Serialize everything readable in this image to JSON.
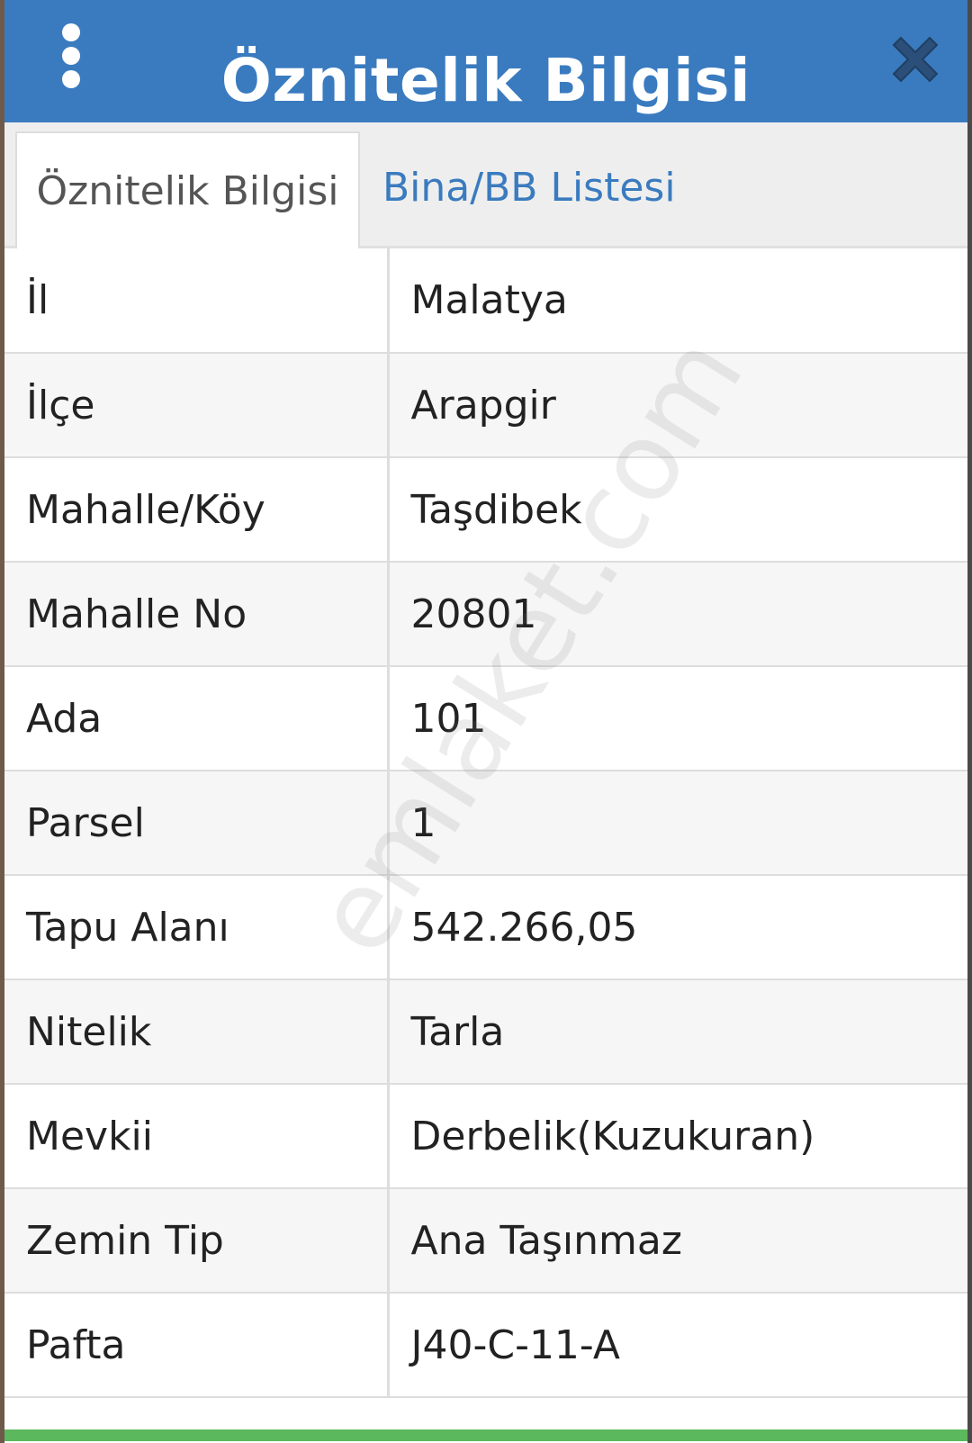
{
  "header": {
    "title": "Öznitelik Bilgisi",
    "background_color": "#3a7bbf",
    "menu_icon": "more-vertical-icon",
    "close_icon": "close-x-icon"
  },
  "tabs": [
    {
      "label": "Öznitelik Bilgisi",
      "active": true
    },
    {
      "label": "Bina/BB Listesi",
      "active": false
    }
  ],
  "attributes": [
    {
      "label": "İl",
      "value": "Malatya"
    },
    {
      "label": "İlçe",
      "value": "Arapgir"
    },
    {
      "label": "Mahalle/Köy",
      "value": "Taşdibek"
    },
    {
      "label": "Mahalle No",
      "value": "20801"
    },
    {
      "label": "Ada",
      "value": "101"
    },
    {
      "label": "Parsel",
      "value": "1"
    },
    {
      "label": "Tapu Alanı",
      "value": "542.266,05"
    },
    {
      "label": "Nitelik",
      "value": "Tarla"
    },
    {
      "label": "Mevkii",
      "value": "Derbelik(Kuzukuran)"
    },
    {
      "label": "Zemin Tip",
      "value": "Ana Taşınmaz"
    },
    {
      "label": "Pafta",
      "value": "J40-C-11-A"
    }
  ],
  "watermark": "emlaket.com",
  "accent_green": "#5cb85c"
}
